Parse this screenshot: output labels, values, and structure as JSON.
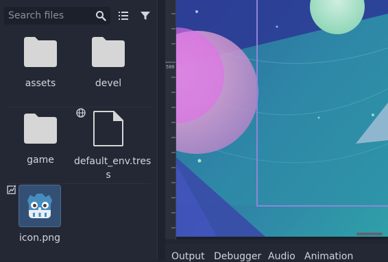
{
  "filesystem": {
    "search_placeholder": "Search files",
    "items": [
      {
        "name": "assets",
        "type": "folder"
      },
      {
        "name": "devel",
        "type": "folder"
      },
      {
        "name": "game",
        "type": "folder"
      },
      {
        "name": "default_env.tres",
        "name_line1": "default_env.tres",
        "name_line2": "s",
        "type": "file"
      },
      {
        "name": "icon.png",
        "type": "image"
      }
    ]
  },
  "viewport": {
    "ruler_label": "500"
  },
  "bottom_panel": {
    "tabs": [
      "Output",
      "Debugger",
      "Audio",
      "Animation"
    ]
  },
  "colors": {
    "folder": "#d6d6d6",
    "accent": "#478cbf",
    "panel": "#232834"
  }
}
